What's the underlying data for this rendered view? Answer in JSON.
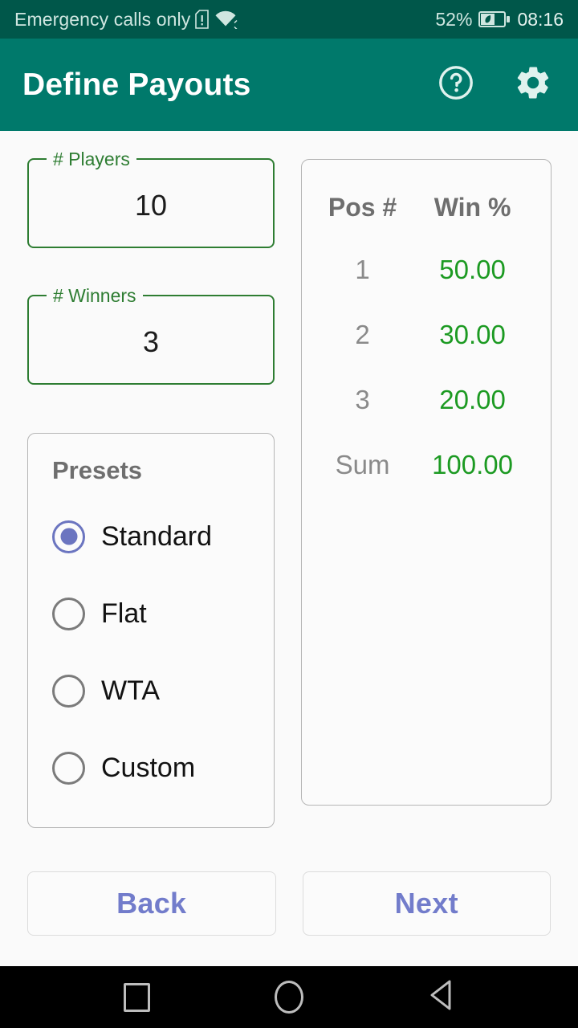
{
  "status_bar": {
    "carrier_text": "Emergency calls only",
    "sim_icon": "sim-alert-icon",
    "wifi_icon": "wifi-icon",
    "battery_percent": "52%",
    "battery_icon": "battery-power-saving-leaf-icon",
    "clock": "08:16"
  },
  "app_bar": {
    "title": "Define Payouts",
    "help_icon": "help-circle-icon",
    "settings_icon": "gear-icon"
  },
  "fields": [
    {
      "label": "# Players",
      "value": "10",
      "name": "players-field"
    },
    {
      "label": "# Winners",
      "value": "3",
      "name": "winners-field"
    }
  ],
  "presets": {
    "title": "Presets",
    "selected": "Standard",
    "options": [
      {
        "label": "Standard",
        "checked": true
      },
      {
        "label": "Flat",
        "checked": false
      },
      {
        "label": "WTA",
        "checked": false
      },
      {
        "label": "Custom",
        "checked": false
      }
    ]
  },
  "payout_table": {
    "headers": [
      "Pos #",
      "Win %"
    ],
    "rows": [
      {
        "pos": "1",
        "win": "50.00"
      },
      {
        "pos": "2",
        "win": "30.00"
      },
      {
        "pos": "3",
        "win": "20.00"
      }
    ],
    "sum_row": {
      "pos": "Sum",
      "win": "100.00"
    }
  },
  "buttons": {
    "back": "Back",
    "next": "Next"
  },
  "nav_bar": {
    "recents_icon": "square-recents-icon",
    "home_icon": "circle-home-icon",
    "back_icon": "triangle-back-icon"
  },
  "colors": {
    "status_bar": "#00574A",
    "app_bar": "#00796B",
    "background": "#FAFAFA",
    "field_green": "#2E7D32",
    "value_green": "#1C9A22",
    "accent_periwinkle": "#6B75C0",
    "muted_gray": "#6E6E6E"
  }
}
